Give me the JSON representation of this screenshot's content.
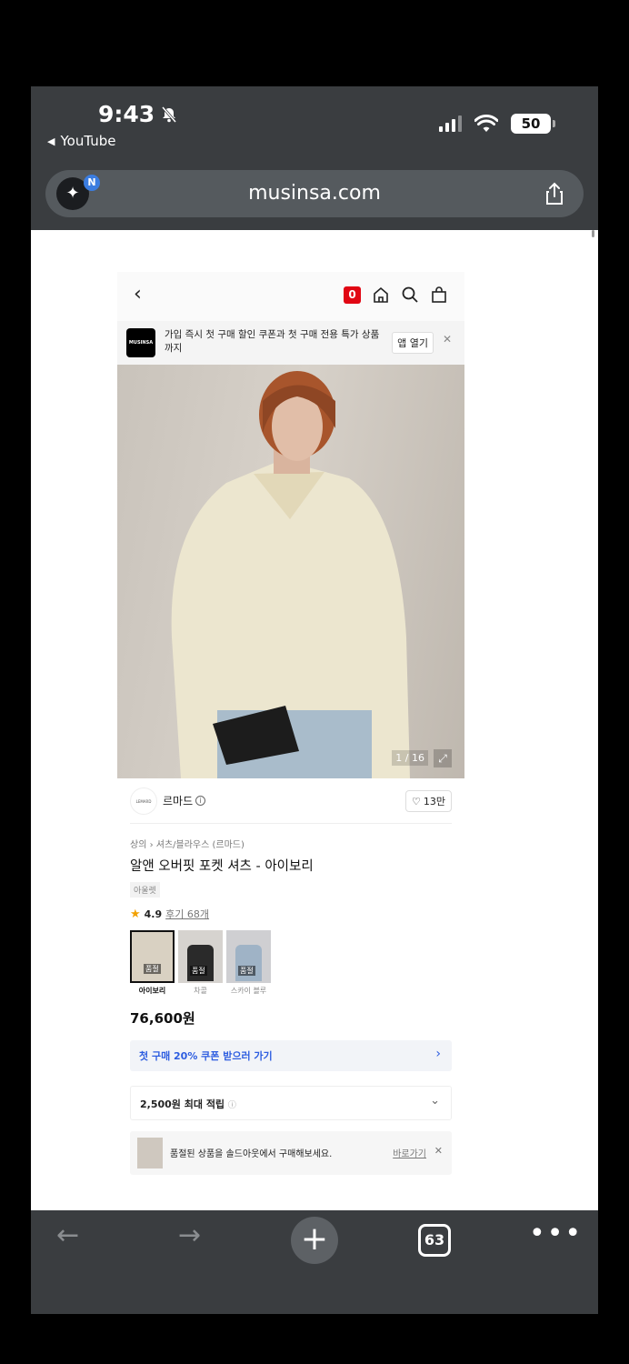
{
  "status_bar": {
    "time": "9:43",
    "back_app": "YouTube",
    "battery": "50"
  },
  "browser": {
    "url": "musinsa.com",
    "ai_badge": "N",
    "tab_count": "63"
  },
  "page": {
    "app_promo": {
      "logo": "MUSINSA",
      "text": "가입 즉시 첫 구매 할인 쿠폰과 첫 구매 전용 특가 상품까지",
      "open_app": "앱 열기"
    },
    "cart_count": "0",
    "image_counter": "1 / 16",
    "brand": {
      "logo": "LEMARD",
      "name": "르마드",
      "likes": "13만"
    },
    "breadcrumb": "상의 › 셔츠/블라우스 (르마드)",
    "title": "알앤 오버핏 포켓 셔츠 - 아이보리",
    "tag": "아울렛",
    "rating": "4.9",
    "reviews": "후기 68개",
    "colors": [
      {
        "name": "아이보리",
        "label": "품절",
        "selected": true
      },
      {
        "name": "차콜",
        "label": "품절",
        "selected": false
      },
      {
        "name": "스카이 블루",
        "label": "품절",
        "selected": false
      }
    ],
    "price": "76,600원",
    "coupon": "첫 구매 20% 쿠폰 받으러 가기",
    "points": "2,500원 최대 적립",
    "soldout_text": "품절된 상품을 솔드아웃에서 구매해보세요.",
    "soldout_link": "바로가기"
  }
}
